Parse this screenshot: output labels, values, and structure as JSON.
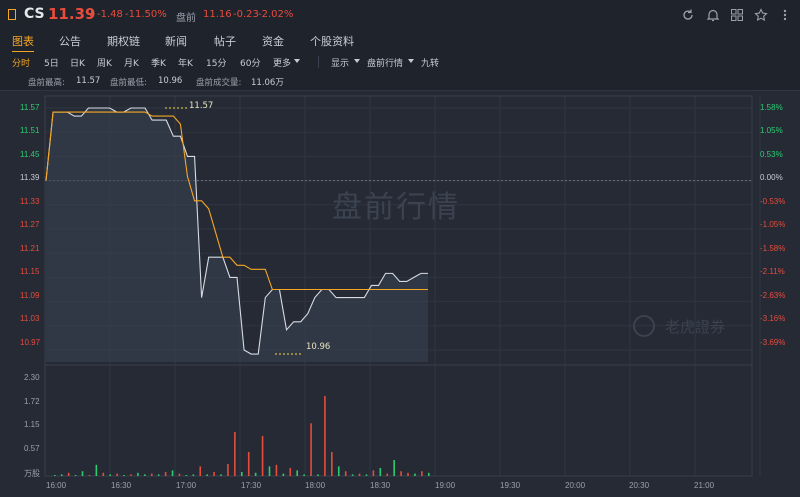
{
  "header": {
    "ticker": "CS",
    "price": "11.39",
    "arrow": "↓",
    "change": "-1.48",
    "change_pct": "-11.50%",
    "premarket_label": "盘前",
    "premarket_price": "11.16",
    "premarket_change": "-0.23",
    "premarket_pct": "-2.02%"
  },
  "tabs": [
    "图表",
    "公告",
    "期权链",
    "新闻",
    "帖子",
    "资金",
    "个股资料"
  ],
  "periods": [
    "分时",
    "5日",
    "日K",
    "周K",
    "月K",
    "季K",
    "年K",
    "15分",
    "60分",
    "更多"
  ],
  "period_tools": [
    "显示",
    "盘前行情",
    "九转"
  ],
  "stats": {
    "high_label": "盘前最高:",
    "high_value": "11.57",
    "low_label": "盘前最低:",
    "low_value": "10.96",
    "volume_label": "盘前成交量:",
    "volume_value": "11.06万"
  },
  "chart": {
    "watermark": "盘前行情",
    "broker_watermark": "老虎證券",
    "y_left": [
      "11.57",
      "11.51",
      "11.45",
      "11.39",
      "11.33",
      "11.27",
      "11.21",
      "11.15",
      "11.09",
      "11.03",
      "10.97"
    ],
    "y_right": [
      "1.58%",
      "1.05%",
      "0.53%",
      "0.00%",
      "-0.53%",
      "-1.05%",
      "-1.58%",
      "-2.11%",
      "-2.63%",
      "-3.16%",
      "-3.69%"
    ],
    "x_labels": [
      "16:00",
      "16:30",
      "17:00",
      "17:30",
      "18:00",
      "18:30",
      "19:00",
      "19:30",
      "20:00",
      "20:30",
      "21:00"
    ],
    "vol_ticks": [
      "2.30",
      "1.72",
      "1.15",
      "0.57"
    ],
    "vol_unit": "万股",
    "high_mark": "11.57",
    "low_mark": "10.96",
    "colors": {
      "up": "#2ecc71",
      "down": "#e74c3c",
      "avg": "#f5a623",
      "price": "#d7dbe3"
    }
  },
  "chart_data": {
    "type": "line",
    "title": "盘前行情",
    "series": [],
    "price": [
      11.39,
      11.56,
      11.56,
      11.56,
      11.55,
      11.55,
      11.57,
      11.57,
      11.57,
      11.57,
      11.56,
      11.56,
      11.57,
      11.57,
      11.57,
      11.54,
      11.54,
      11.54,
      11.5,
      11.5,
      11.45,
      11.45,
      11.1,
      11.2,
      11.2,
      11.2,
      11.15,
      11.15,
      10.97,
      10.96,
      10.96,
      11.1,
      11.12,
      11.12,
      11.02,
      11.04,
      11.04,
      11.06,
      11.1,
      11.12,
      11.12,
      11.1,
      11.1,
      11.1,
      11.1,
      11.1,
      11.13,
      11.13,
      11.16,
      11.16,
      11.14,
      11.14,
      11.15,
      11.16,
      11.16
    ],
    "avg": [
      11.39,
      11.56,
      11.56,
      11.56,
      11.56,
      11.56,
      11.56,
      11.56,
      11.56,
      11.56,
      11.56,
      11.56,
      11.56,
      11.56,
      11.56,
      11.55,
      11.55,
      11.55,
      11.55,
      11.53,
      11.4,
      11.34,
      11.34,
      11.32,
      11.26,
      11.2,
      11.2,
      11.18,
      11.18,
      11.17,
      11.17,
      11.17,
      11.12,
      11.12,
      11.12,
      11.12,
      11.12,
      11.12,
      11.12,
      11.12,
      11.12,
      11.12,
      11.12,
      11.12,
      11.12,
      11.12,
      11.12,
      11.12,
      11.12,
      11.12,
      11.12,
      11.12,
      11.12,
      11.12,
      11.12
    ],
    "ylim": [
      10.94,
      11.59
    ],
    "prev_close": 11.39
  }
}
